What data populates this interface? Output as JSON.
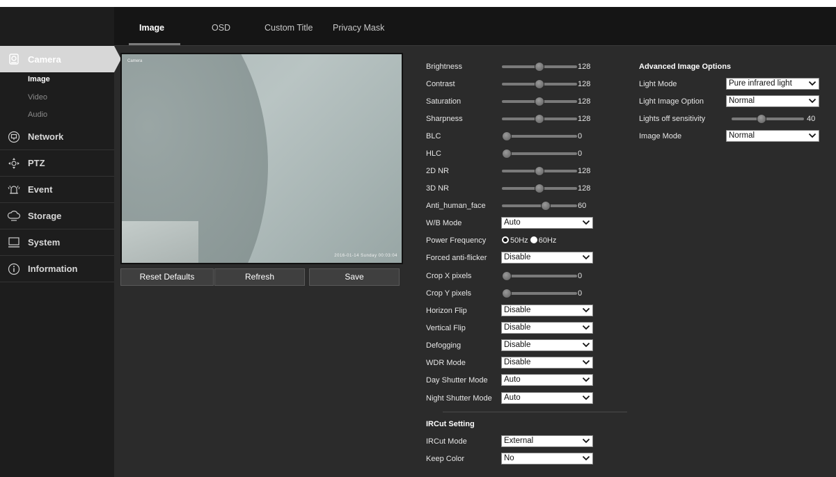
{
  "tabs": [
    {
      "label": "Image",
      "active": true
    },
    {
      "label": "OSD"
    },
    {
      "label": "Custom Title"
    },
    {
      "label": "Privacy Mask"
    }
  ],
  "sidebar": {
    "camera": {
      "label": "Camera",
      "icon": "camera-icon",
      "active": true
    },
    "sub_items": [
      {
        "label": "Image",
        "active": true
      },
      {
        "label": "Video"
      },
      {
        "label": "Audio"
      }
    ],
    "network": {
      "label": "Network",
      "icon": "network-icon"
    },
    "ptz": {
      "label": "PTZ",
      "icon": "ptz-icon"
    },
    "event": {
      "label": "Event",
      "icon": "event-icon"
    },
    "storage": {
      "label": "Storage",
      "icon": "storage-icon"
    },
    "system": {
      "label": "System",
      "icon": "system-icon"
    },
    "information": {
      "label": "Information",
      "icon": "information-icon"
    }
  },
  "preview": {
    "osd_top_left": "Camera",
    "osd_bottom_right": "2016-01-14 Sunday 00:03:04"
  },
  "buttons": {
    "reset": "Reset Defaults",
    "refresh": "Refresh",
    "save": "Save"
  },
  "settings": {
    "brightness": {
      "label": "Brightness",
      "value": "128",
      "level": 0.5
    },
    "contrast": {
      "label": "Contrast",
      "value": "128",
      "level": 0.5
    },
    "saturation": {
      "label": "Saturation",
      "value": "128",
      "level": 0.5
    },
    "sharpness": {
      "label": "Sharpness",
      "value": "128",
      "level": 0.5
    },
    "blc": {
      "label": "BLC",
      "value": "0",
      "level": 0.0
    },
    "hlc": {
      "label": "HLC",
      "value": "0",
      "level": 0.0
    },
    "nr2d": {
      "label": "2D NR",
      "value": "128",
      "level": 0.5
    },
    "nr3d": {
      "label": "3D NR",
      "value": "128",
      "level": 0.5
    },
    "anti_face": {
      "label": "Anti_human_face",
      "value": "60",
      "level": 0.6
    },
    "wb_mode": {
      "label": "W/B Mode",
      "value": "Auto"
    },
    "power_frequency": {
      "label": "Power Frequency",
      "opt_50": "50Hz",
      "opt_60": "60Hz",
      "selected": "50Hz"
    },
    "anti_flicker": {
      "label": "Forced anti-flicker",
      "value": "Disable"
    },
    "crop_x": {
      "label": "Crop X pixels",
      "value": "0",
      "level": 0.0
    },
    "crop_y": {
      "label": "Crop Y pixels",
      "value": "0",
      "level": 0.0
    },
    "horizon_flip": {
      "label": "Horizon Flip",
      "value": "Disable"
    },
    "vertical_flip": {
      "label": "Vertical Flip",
      "value": "Disable"
    },
    "defogging": {
      "label": "Defogging",
      "value": "Disable"
    },
    "wdr_mode": {
      "label": "WDR Mode",
      "value": "Disable"
    },
    "day_shutter": {
      "label": "Day Shutter Mode",
      "value": "Auto"
    },
    "night_shutter": {
      "label": "Night Shutter Mode",
      "value": "Auto"
    }
  },
  "ircut": {
    "title": "IRCut Setting",
    "mode": {
      "label": "IRCut Mode",
      "value": "External"
    },
    "keep_color": {
      "label": "Keep Color",
      "value": "No"
    }
  },
  "advanced": {
    "title": "Advanced Image Options",
    "light_mode": {
      "label": "Light Mode",
      "value": "Pure infrared light"
    },
    "light_image_option": {
      "label": "Light Image Option",
      "value": "Normal"
    },
    "lights_off_sensitivity": {
      "label": "Lights off sensitivity",
      "value": "40",
      "level": 0.4
    },
    "image_mode": {
      "label": "Image Mode",
      "value": "Normal"
    }
  },
  "colors": {
    "background": "#2b2b2b",
    "sidebar": "#1d1d1d",
    "topbar": "#151515",
    "active_tab": "#d7d7d7"
  }
}
